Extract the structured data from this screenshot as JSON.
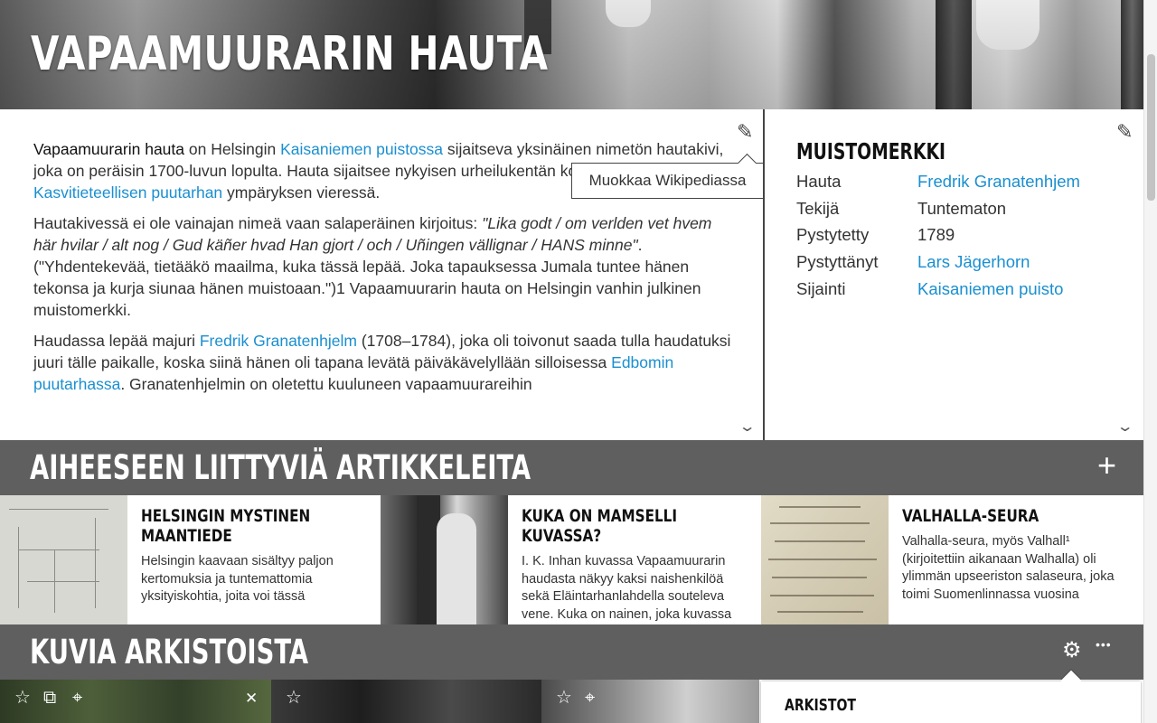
{
  "hero": {
    "title": "VAPAAMUURARIN HAUTA"
  },
  "article": {
    "edit_tooltip": "Muokkaa Wikipediassa",
    "p1": {
      "bold": "Vapaamuurarin hauta",
      "t1": " on Helsingin ",
      "link1": "Kaisaniemen puistossa",
      "t2": " sijaitseva yksinäinen nimetön hautakivi, joka on peräisin 1700-luvun lopulta. Hauta sijaitsee nykyisen urheilukentän koilliskulman tuntumassa ",
      "link2": "Kasvitieteellisen puutarhan",
      "t3": " ympäryksen vieressä."
    },
    "p2": {
      "t1": "Hautakivessä ei ole vainajan nimeä vaan salaperäinen kirjoitus: ",
      "quote": "\"Lika godt / om verlden vet hvem här hvilar / alt nog / Gud käñer hvad Han gjort / och / Uñingen vällignar / HANS minne\"",
      "t2": ". (\"Yhdentekevää, tietääkö maailma, kuka tässä lepää. Joka tapauksessa Jumala tuntee hänen tekonsa ja kurja siunaa hänen muistoaan.\")1 Vapaamuurarin hauta on Helsingin vanhin julkinen muistomerkki."
    },
    "p3": {
      "t1": "Haudassa lepää majuri ",
      "link1": "Fredrik Granatenhjelm",
      "t2": " (1708–1784), joka oli toivonut saada tulla haudatuksi juuri tälle paikalle, koska siinä hänen oli tapana levätä päiväkävelyllään silloisessa ",
      "link2": "Edbomin puutarhassa",
      "t3": ". Granatenhjelmin on oletettu kuuluneen vapaamuurareihin"
    }
  },
  "infobox": {
    "title": "MUISTOMERKKI",
    "rows": [
      {
        "key": "Hauta",
        "value": "Fredrik Granatenhjem"
      },
      {
        "key": "Tekijä",
        "value": "Tuntematon"
      },
      {
        "key": "Pystytetty",
        "value": "1789"
      },
      {
        "key": "Pystyttänyt",
        "value": "Lars Jägerhorn"
      },
      {
        "key": "Sijainti",
        "value": "Kaisaniemen puisto"
      }
    ]
  },
  "related": {
    "title": "AIHEESEEN LIITTYVIÄ ARTIKKELEITA",
    "add_icon": "plus-icon",
    "cards": [
      {
        "title": "HELSINGIN MYSTINEN MAANTIEDE",
        "text": "Helsingin kaavaan sisältyy paljon kertomuksia ja tuntemattomia yksityiskohtia, joita voi tässä"
      },
      {
        "title": "KUKA ON MAMSELLI KUVASSA?",
        "text": "I. K. Inhan kuvassa Vapaamuurarin haudasta näkyy kaksi naishenkilöä sekä Eläintarhanlahdella souteleva vene. Kuka on nainen, joka kuvassa"
      },
      {
        "title": "VALHALLA-SEURA",
        "text": "Valhalla-seura, myös Valhall¹ (kirjoitettiin aikanaan Walhalla) oli ylimmän upseeriston salaseura, joka toimi Suomenlinnassa vuosina"
      }
    ]
  },
  "archive": {
    "title": "KUVIA ARKISTOISTA",
    "panel_title": "ARKISTOT"
  },
  "icons": {
    "star": "☆",
    "gallery": "⧉",
    "pin": "⌖",
    "close": "✕",
    "gear": "⚙",
    "more": "•••",
    "pencil": "✎",
    "chevron": "⌄",
    "plus": "+"
  }
}
